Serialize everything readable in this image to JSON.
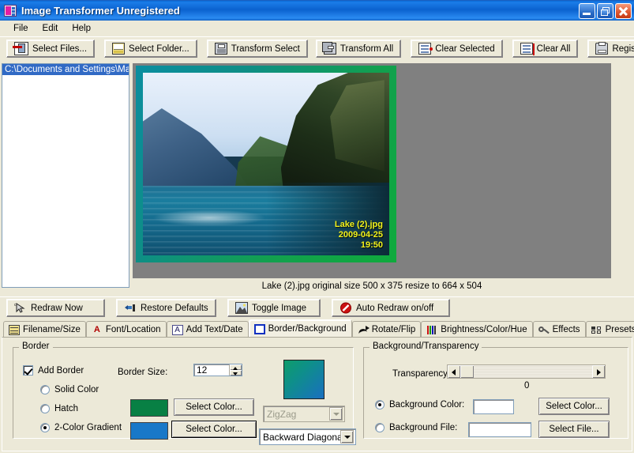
{
  "window": {
    "title": "Image Transformer Unregistered",
    "icon": "app-icon",
    "controls": {
      "minimize": "Minimize",
      "restore": "Restore",
      "close": "Close"
    }
  },
  "menu": {
    "items": [
      "File",
      "Edit",
      "Help"
    ]
  },
  "toolbar_main": {
    "buttons": [
      {
        "label": "Select Files...",
        "icon": "select-files-icon"
      },
      {
        "label": "Select Folder...",
        "icon": "select-folder-icon"
      },
      {
        "label": "Transform Select",
        "icon": "floppy-disk-icon"
      },
      {
        "label": "Transform All",
        "icon": "floppy-disks-icon"
      },
      {
        "label": "Clear Selected",
        "icon": "clear-selected-icon"
      },
      {
        "label": "Clear All",
        "icon": "clear-all-icon"
      },
      {
        "label": "Register...",
        "icon": "register-icon"
      }
    ]
  },
  "file_list": {
    "items": [
      {
        "label": "C:\\Documents and Settings\\Max",
        "selected": true
      }
    ]
  },
  "preview": {
    "overlay": {
      "filename": "Lake (2).jpg",
      "date": "2009-04-25",
      "time": "19:50"
    },
    "status": "Lake (2).jpg original size 500 x 375 resize to 664 x 504",
    "canvas_color": "#808080",
    "border_gradient_from": "#0b8ea0",
    "border_gradient_to": "#0faa3c"
  },
  "toolbar_actions": {
    "buttons": [
      {
        "label": "Redraw Now",
        "icon": "cursor-redraw-icon"
      },
      {
        "label": "Restore Defaults",
        "icon": "restore-defaults-icon"
      },
      {
        "label": "Toggle Image",
        "icon": "picture-icon"
      },
      {
        "label": "Auto Redraw on/off",
        "icon": "no-entry-icon"
      }
    ]
  },
  "tabs": [
    {
      "label": "Filename/Size",
      "icon": "filename-size-icon",
      "active": false
    },
    {
      "label": "Font/Location",
      "icon": "font-location-icon",
      "active": false
    },
    {
      "label": "Add Text/Date",
      "icon": "add-text-icon",
      "active": false
    },
    {
      "label": "Border/Background",
      "icon": "border-background-icon",
      "active": true
    },
    {
      "label": "Rotate/Flip",
      "icon": "rotate-flip-icon",
      "active": false
    },
    {
      "label": "Brightness/Color/Hue",
      "icon": "brightness-icon",
      "active": false
    },
    {
      "label": "Effects",
      "icon": "effects-wrench-icon",
      "active": false
    },
    {
      "label": "Presets",
      "icon": "presets-grid-icon",
      "active": false
    }
  ],
  "border_group": {
    "title": "Border",
    "add_border_label": "Add Border",
    "add_border_checked": true,
    "border_size_label": "Border Size:",
    "border_size_value": "12",
    "options": [
      {
        "label": "Solid Color",
        "selected": false
      },
      {
        "label": "Hatch",
        "selected": false
      },
      {
        "label": "2-Color Gradient",
        "selected": true
      }
    ],
    "color1": "#088044",
    "color2": "#1878c8",
    "select_color_1_label": "Select Color...",
    "select_color_2_label": "Select Color...",
    "hatch_style": "ZigZag",
    "hatch_enabled": false,
    "gradient_style": "Backward Diagonal",
    "gradient_preview_from": "#0f9c6a",
    "gradient_preview_to": "#1a6fc0"
  },
  "background_group": {
    "title": "Background/Transparency",
    "transparency_label": "Transparency:",
    "transparency_value": "0",
    "bg_color_label": "Background Color:",
    "bg_color_selected": true,
    "bg_color_value": "",
    "select_color_label": "Select Color...",
    "bg_file_label": "Background File:",
    "bg_file_selected": false,
    "bg_file_value": "",
    "select_file_label": "Select File..."
  }
}
